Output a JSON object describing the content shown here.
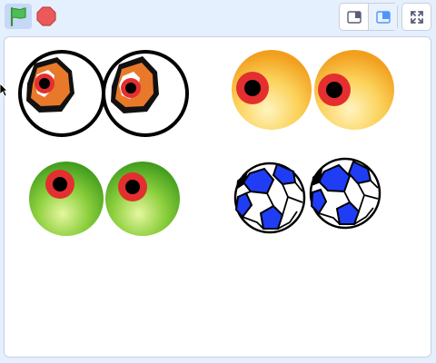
{
  "toolbar": {
    "green_flag": {
      "icon": "green-flag-icon",
      "color": "#4cbf56"
    },
    "stop": {
      "icon": "stop-sign-icon",
      "color": "#ec5959"
    },
    "stage_modes": [
      {
        "icon": "small-stage-icon",
        "active": false
      },
      {
        "icon": "normal-stage-icon",
        "active": true
      }
    ],
    "fullscreen": {
      "icon": "fullscreen-icon"
    }
  },
  "stage": {
    "background": "#ffffff",
    "sprites": [
      {
        "name": "cartoon-eyes",
        "colors": [
          "#ffffff",
          "#e87d2b",
          "#e33b2e",
          "#000000"
        ]
      },
      {
        "name": "orange-eyes",
        "colors": [
          "#f5a623",
          "#fde58c",
          "#e33b2e",
          "#000000"
        ]
      },
      {
        "name": "green-eyes",
        "colors": [
          "#49a81f",
          "#b5e36a",
          "#e33b2e",
          "#000000"
        ]
      },
      {
        "name": "soccer-ball-eyes",
        "colors": [
          "#1f3df5",
          "#ffffff",
          "#000000"
        ]
      }
    ]
  },
  "accent": "#4c97ff"
}
